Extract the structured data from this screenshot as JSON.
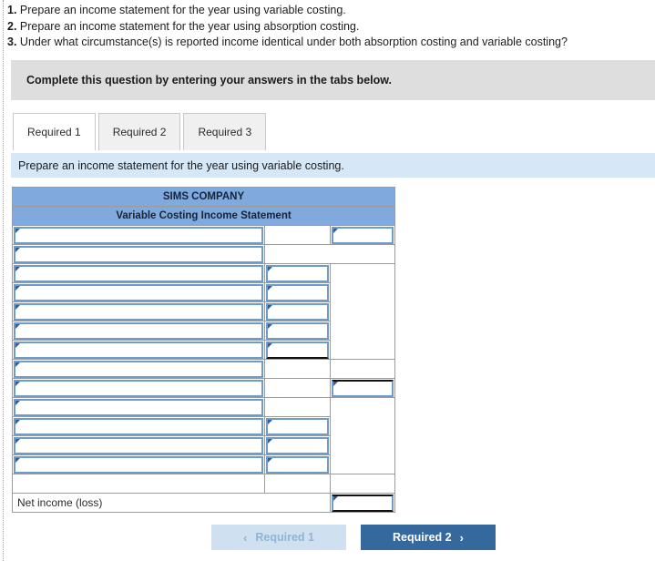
{
  "questions": [
    {
      "num": "1.",
      "text": "Prepare an income statement for the year using variable costing."
    },
    {
      "num": "2.",
      "text": "Prepare an income statement for the year using absorption costing."
    },
    {
      "num": "3.",
      "text": "Under what circumstance(s) is reported income identical under both absorption costing and variable costing?"
    }
  ],
  "banner": {
    "text": "Complete this question by entering your answers in the tabs below."
  },
  "tabs": [
    {
      "label": "Required 1",
      "active": true
    },
    {
      "label": "Required 2",
      "active": false
    },
    {
      "label": "Required 3",
      "active": false
    }
  ],
  "subbar": {
    "text": "Prepare an income statement for the year using variable costing."
  },
  "statement": {
    "company": "SIMS COMPANY",
    "title": "Variable Costing Income Statement",
    "net_income_label": "Net income (loss)",
    "rows": [
      {
        "label": "",
        "amt1": "",
        "amt2": "",
        "label_input": true,
        "amt1_input": false,
        "amt2_input": true,
        "amt2_thick_top": false
      },
      {
        "label": "",
        "amt1": "",
        "amt2": "",
        "label_input": true,
        "amt1_input": false,
        "amt2_input": false,
        "merge_amt": true
      },
      {
        "label": "",
        "amt1": "",
        "amt2": "",
        "label_input": true,
        "amt1_input": true,
        "amt2_input": false,
        "amt2_span_start": true
      },
      {
        "label": "",
        "amt1": "",
        "amt2": "",
        "label_input": true,
        "amt1_input": true,
        "amt2_input": false
      },
      {
        "label": "",
        "amt1": "",
        "amt2": "",
        "label_input": true,
        "amt1_input": true,
        "amt2_input": false
      },
      {
        "label": "",
        "amt1": "",
        "amt2": "",
        "label_input": true,
        "amt1_input": true,
        "amt2_input": false
      },
      {
        "label": "",
        "amt1": "",
        "amt2": "",
        "label_input": true,
        "amt1_input": true,
        "amt2_input": false
      },
      {
        "label": "",
        "amt1": "",
        "amt2": "",
        "label_input": true,
        "amt1_input": false,
        "amt2_input": false
      },
      {
        "label": "",
        "amt1": "",
        "amt2": "",
        "label_input": true,
        "amt1_input": false,
        "amt2_input": true,
        "amt2_thick_top": true
      },
      {
        "label": "",
        "amt1": "",
        "amt2": "",
        "label_input": true,
        "amt1_input": false,
        "amt2_input": false
      },
      {
        "label": "",
        "amt1": "",
        "amt2": "",
        "label_input": true,
        "amt1_input": true,
        "amt2_input": false
      },
      {
        "label": "",
        "amt1": "",
        "amt2": "",
        "label_input": true,
        "amt1_input": true,
        "amt2_input": false
      },
      {
        "label": "",
        "amt1": "",
        "amt2": "",
        "label_input": true,
        "amt1_input": true,
        "amt2_input": false
      },
      {
        "label": "",
        "amt1": "",
        "amt2": "",
        "label_input": false,
        "amt1_input": false,
        "amt2_input": false
      }
    ]
  },
  "nav": {
    "prev_label": "Required 1",
    "next_label": "Required 2",
    "prev_icon": "chevron-left-icon",
    "next_icon": "chevron-right-icon",
    "chev_left": "‹",
    "chev_right": "›"
  },
  "colors": {
    "header_blue": "#80aadd",
    "subbar_blue": "#d6e8f7",
    "banner_gray": "#dedede",
    "input_border": "#6f9bc8",
    "btn_active": "#35699e",
    "btn_disabled": "#cfe0f0"
  }
}
